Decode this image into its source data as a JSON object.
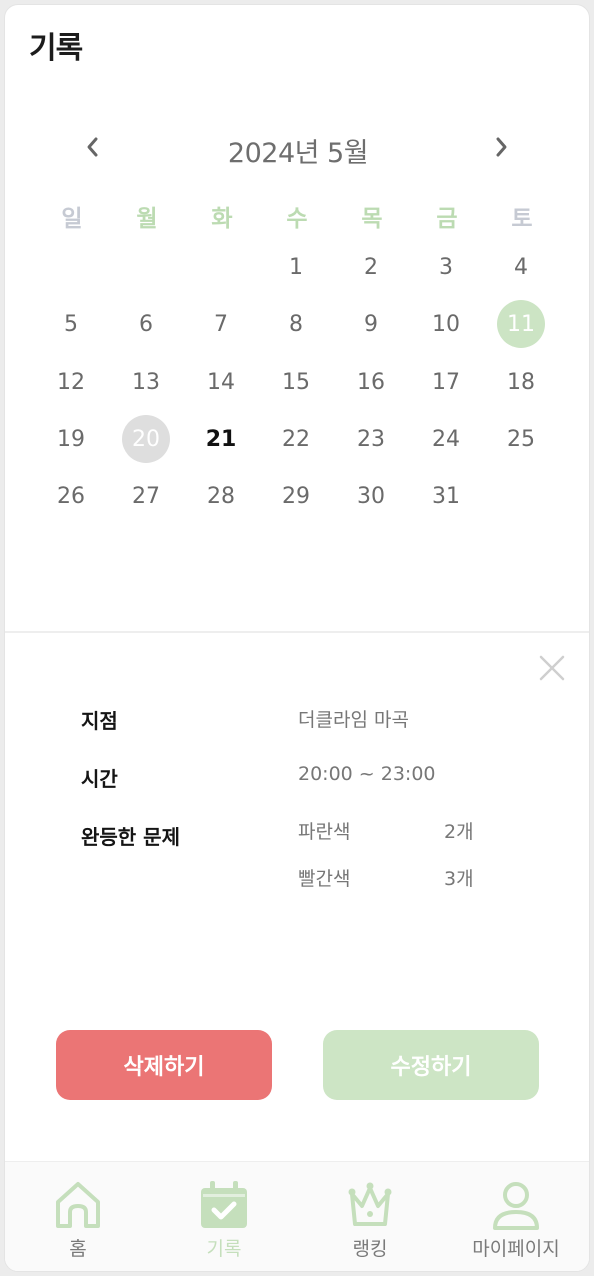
{
  "header": {
    "title": "기록"
  },
  "calendar": {
    "month_label": "2024년 5월",
    "weekdays": [
      "일",
      "월",
      "화",
      "수",
      "목",
      "금",
      "토"
    ],
    "colors": {
      "weekday_weekend": "#c6cad3",
      "weekday_weekday": "#bcdbb2",
      "visited": "#cce4c4",
      "selected": "#dedede"
    },
    "visited_day": 11,
    "selected_day": 20,
    "today_day": 21,
    "days": [
      "1",
      "2",
      "3",
      "4",
      "5",
      "6",
      "7",
      "8",
      "9",
      "10",
      "11",
      "12",
      "13",
      "14",
      "15",
      "16",
      "17",
      "18",
      "19",
      "20",
      "21",
      "22",
      "23",
      "24",
      "25",
      "26",
      "27",
      "28",
      "29",
      "30",
      "31"
    ]
  },
  "detail": {
    "location_label": "지점",
    "location_value": "더클라임 마곡",
    "time_label": "시간",
    "time_value": "20:00 ~ 23:00",
    "problems_label": "완등한 문제",
    "problems": [
      {
        "color": "파란색",
        "count": "2개"
      },
      {
        "color": "빨간색",
        "count": "3개"
      }
    ]
  },
  "actions": {
    "delete_label": "삭제하기",
    "edit_label": "수정하기",
    "delete_color": "#eb7575",
    "edit_color": "#cde5c5"
  },
  "bottom_nav": {
    "items": [
      {
        "label": "홈",
        "icon": "home-icon"
      },
      {
        "label": "기록",
        "icon": "calendar-check-icon",
        "active": true
      },
      {
        "label": "랭킹",
        "icon": "crown-icon"
      },
      {
        "label": "마이페이지",
        "icon": "user-icon"
      }
    ],
    "active_color": "#c5dfbc"
  }
}
